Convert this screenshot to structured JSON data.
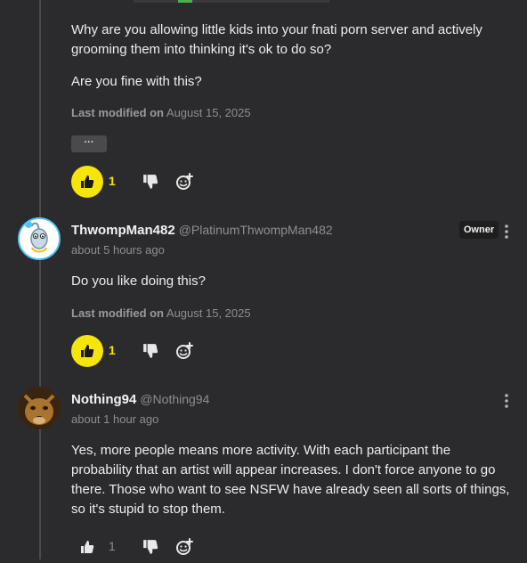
{
  "comment_top": {
    "body_lines": [
      "Why are you allowing little kids into your fnati porn server and actively",
      "grooming them into thinking it's ok to do so?"
    ],
    "body_second": "Are you fine with this?",
    "modified_prefix": "Last modified on",
    "modified_date": "August 15, 2025",
    "collapse_label": "···",
    "likes": "1"
  },
  "comment_thwomp": {
    "username": "ThwompMan482",
    "handle": "@PlatinumThwompMan482",
    "timestamp": "about 5 hours ago",
    "badge": "Owner",
    "body": "Do you like doing this?",
    "modified_prefix": "Last modified on",
    "modified_date": "August 15, 2025",
    "likes": "1"
  },
  "comment_nothing": {
    "username": "Nothing94",
    "handle": "@Nothing94",
    "timestamp": "about 1 hour ago",
    "body_lines": [
      "Yes, more people means more activity. With each participant the",
      "probability that an artist will appear increases. I don't force anyone to go",
      "there. Those who want to see NSFW have already seen all sorts of things,",
      "so it's stupid to stop them."
    ],
    "likes": "1"
  },
  "colors": {
    "background": "#2b2b2d",
    "like_active": "#f5e50a",
    "owner_badge_bg": "#1e1e1f",
    "thwomp_avatar_ring": "#4fc3f7"
  },
  "icons": [
    "thumbs-up-icon",
    "thumbs-down-icon",
    "add-reaction-icon",
    "kebab-menu-icon"
  ]
}
